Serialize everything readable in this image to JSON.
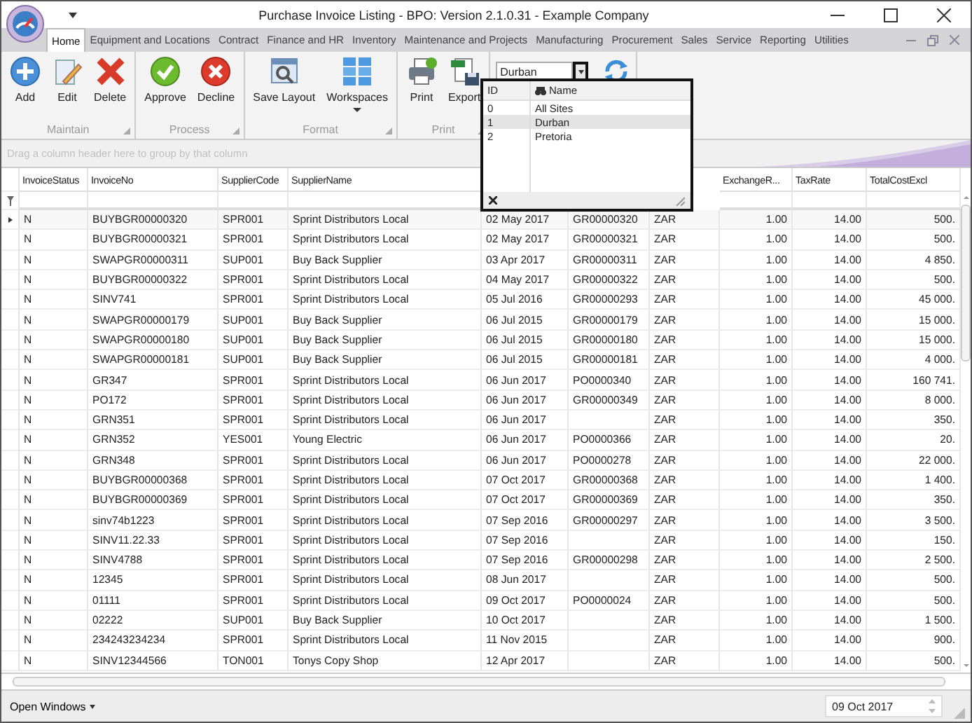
{
  "window": {
    "title": "Purchase Invoice Listing - BPO: Version 2.1.0.31 - Example Company"
  },
  "tabs": [
    {
      "label": "Home",
      "selected": true
    },
    {
      "label": "Equipment and Locations",
      "selected": false
    },
    {
      "label": "Contract",
      "selected": false
    },
    {
      "label": "Finance and HR",
      "selected": false
    },
    {
      "label": "Inventory",
      "selected": false
    },
    {
      "label": "Maintenance and Projects",
      "selected": false
    },
    {
      "label": "Manufacturing",
      "selected": false
    },
    {
      "label": "Procurement",
      "selected": false
    },
    {
      "label": "Sales",
      "selected": false
    },
    {
      "label": "Service",
      "selected": false
    },
    {
      "label": "Reporting",
      "selected": false
    },
    {
      "label": "Utilities",
      "selected": false
    }
  ],
  "ribbon_groups": [
    {
      "label": "Maintain",
      "buttons": [
        {
          "label": "Add",
          "kind": "add"
        },
        {
          "label": "Edit",
          "kind": "edit"
        },
        {
          "label": "Delete",
          "kind": "delete"
        }
      ]
    },
    {
      "label": "Process",
      "buttons": [
        {
          "label": "Approve",
          "kind": "approve"
        },
        {
          "label": "Decline",
          "kind": "decline"
        }
      ]
    },
    {
      "label": "Format",
      "buttons": [
        {
          "label": "Save Layout",
          "kind": "layout"
        },
        {
          "label": "Workspaces",
          "kind": "workspaces"
        }
      ]
    },
    {
      "label": "Print",
      "buttons": [
        {
          "label": "Print",
          "kind": "print"
        },
        {
          "label": "Export",
          "kind": "export"
        }
      ]
    }
  ],
  "site_combo": {
    "value": "Durban"
  },
  "site_dropdown": {
    "columns": [
      "ID",
      "Name"
    ],
    "items": [
      {
        "id": "0",
        "name": "All Sites",
        "selected": false
      },
      {
        "id": "1",
        "name": "Durban",
        "selected": true
      },
      {
        "id": "2",
        "name": "Pretoria",
        "selected": false
      }
    ]
  },
  "group_panel": {
    "hint": "Drag a column header here to group by that column"
  },
  "table": {
    "columns": [
      "InvoiceStatus",
      "InvoiceNo",
      "SupplierCode",
      "SupplierName",
      "",
      "",
      "",
      "ExchangeR...",
      "TaxRate",
      "TotalCostExcl"
    ],
    "rows": [
      {
        "selected": true,
        "cells": [
          "N",
          "BUYBGR00000320",
          "SPR001",
          "Sprint Distributors Local",
          "02 May 2017",
          "GR00000320",
          "ZAR",
          "1.00",
          "14.00",
          "500."
        ]
      },
      {
        "selected": false,
        "cells": [
          "N",
          "BUYBGR00000321",
          "SPR001",
          "Sprint Distributors Local",
          "02 May 2017",
          "GR00000321",
          "ZAR",
          "1.00",
          "14.00",
          "500."
        ]
      },
      {
        "selected": false,
        "cells": [
          "N",
          "SWAPGR00000311",
          "SUP001",
          "Buy Back Supplier",
          "03 Apr 2017",
          "GR00000311",
          "ZAR",
          "1.00",
          "14.00",
          "4 850."
        ]
      },
      {
        "selected": false,
        "cells": [
          "N",
          "BUYBGR00000322",
          "SPR001",
          "Sprint Distributors Local",
          "04 May 2017",
          "GR00000322",
          "ZAR",
          "1.00",
          "14.00",
          "500."
        ]
      },
      {
        "selected": false,
        "cells": [
          "N",
          "SINV741",
          "SPR001",
          "Sprint Distributors Local",
          "05 Jul 2016",
          "GR00000293",
          "ZAR",
          "1.00",
          "14.00",
          "45 000."
        ]
      },
      {
        "selected": false,
        "cells": [
          "N",
          "SWAPGR00000179",
          "SUP001",
          "Buy Back Supplier",
          "06 Jul 2015",
          "GR00000179",
          "ZAR",
          "1.00",
          "14.00",
          "15 000."
        ]
      },
      {
        "selected": false,
        "cells": [
          "N",
          "SWAPGR00000180",
          "SUP001",
          "Buy Back Supplier",
          "06 Jul 2015",
          "GR00000180",
          "ZAR",
          "1.00",
          "14.00",
          "15 000."
        ]
      },
      {
        "selected": false,
        "cells": [
          "N",
          "SWAPGR00000181",
          "SUP001",
          "Buy Back Supplier",
          "06 Jul 2015",
          "GR00000181",
          "ZAR",
          "1.00",
          "14.00",
          "4 000."
        ]
      },
      {
        "selected": false,
        "cells": [
          "N",
          "GR347",
          "SPR001",
          "Sprint Distributors Local",
          "06 Jun 2017",
          "PO0000340",
          "ZAR",
          "1.00",
          "14.00",
          "160 741."
        ]
      },
      {
        "selected": false,
        "cells": [
          "N",
          "PO172",
          "SPR001",
          "Sprint Distributors Local",
          "06 Jun 2017",
          "GR00000349",
          "ZAR",
          "1.00",
          "14.00",
          "8 000."
        ]
      },
      {
        "selected": false,
        "cells": [
          "N",
          "GRN351",
          "SPR001",
          "Sprint Distributors Local",
          "06 Jun 2017",
          null,
          "ZAR",
          "1.00",
          "14.00",
          "350."
        ]
      },
      {
        "selected": false,
        "cells": [
          "N",
          "GRN352",
          "YES001",
          "Young Electric",
          "06 Jun 2017",
          "PO0000366",
          "ZAR",
          "1.00",
          "14.00",
          "20."
        ]
      },
      {
        "selected": false,
        "cells": [
          "N",
          "GRN348",
          "SPR001",
          "Sprint Distributors Local",
          "06 Jun 2017",
          "PO0000278",
          "ZAR",
          "1.00",
          "14.00",
          "22 000."
        ]
      },
      {
        "selected": false,
        "cells": [
          "N",
          "BUYBGR00000368",
          "SPR001",
          "Sprint Distributors Local",
          "07 Oct 2017",
          "GR00000368",
          "ZAR",
          "1.00",
          "14.00",
          "1 400."
        ]
      },
      {
        "selected": false,
        "cells": [
          "N",
          "BUYBGR00000369",
          "SPR001",
          "Sprint Distributors Local",
          "07 Oct 2017",
          "GR00000369",
          "ZAR",
          "1.00",
          "14.00",
          "350."
        ]
      },
      {
        "selected": false,
        "cells": [
          "N",
          "sinv74b1223",
          "SPR001",
          "Sprint Distributors Local",
          "07 Sep 2016",
          "GR00000297",
          "ZAR",
          "1.00",
          "14.00",
          "3 500."
        ]
      },
      {
        "selected": false,
        "cells": [
          "N",
          "SINV11.22.33",
          "SPR001",
          "Sprint Distributors Local",
          "07 Sep 2016",
          null,
          "ZAR",
          "1.00",
          "14.00",
          "150."
        ]
      },
      {
        "selected": false,
        "cells": [
          "N",
          "SINV4788",
          "SPR001",
          "Sprint Distributors Local",
          "07 Sep 2016",
          "GR00000298",
          "ZAR",
          "1.00",
          "14.00",
          "2 500."
        ]
      },
      {
        "selected": false,
        "cells": [
          "N",
          "12345",
          "SPR001",
          "Sprint Distributors Local",
          "08 Jun 2017",
          null,
          "ZAR",
          "1.00",
          "14.00",
          "500."
        ]
      },
      {
        "selected": false,
        "cells": [
          "N",
          "01111",
          "SPR001",
          "Sprint Distributors Local",
          "09 Oct 2017",
          "PO0000024",
          "ZAR",
          "1.00",
          "14.00",
          "500."
        ]
      },
      {
        "selected": false,
        "cells": [
          "N",
          "02222",
          "SUP001",
          "Buy Back Supplier",
          "10 Oct 2017",
          null,
          "ZAR",
          "1.00",
          "14.00",
          "1 500."
        ]
      },
      {
        "selected": false,
        "cells": [
          "N",
          "234243234234",
          "SPR001",
          "Sprint Distributors Local",
          "11 Nov 2015",
          null,
          "ZAR",
          "1.00",
          "14.00",
          "900."
        ]
      },
      {
        "selected": false,
        "cells": [
          "N",
          "SINV12344566",
          "TON001",
          "Tonys Copy Shop",
          "12 Apr 2017",
          null,
          "ZAR",
          "1.00",
          "14.00",
          "500."
        ]
      }
    ]
  },
  "status_bar": {
    "open_windows": "Open Windows",
    "date": "09 Oct 2017"
  }
}
